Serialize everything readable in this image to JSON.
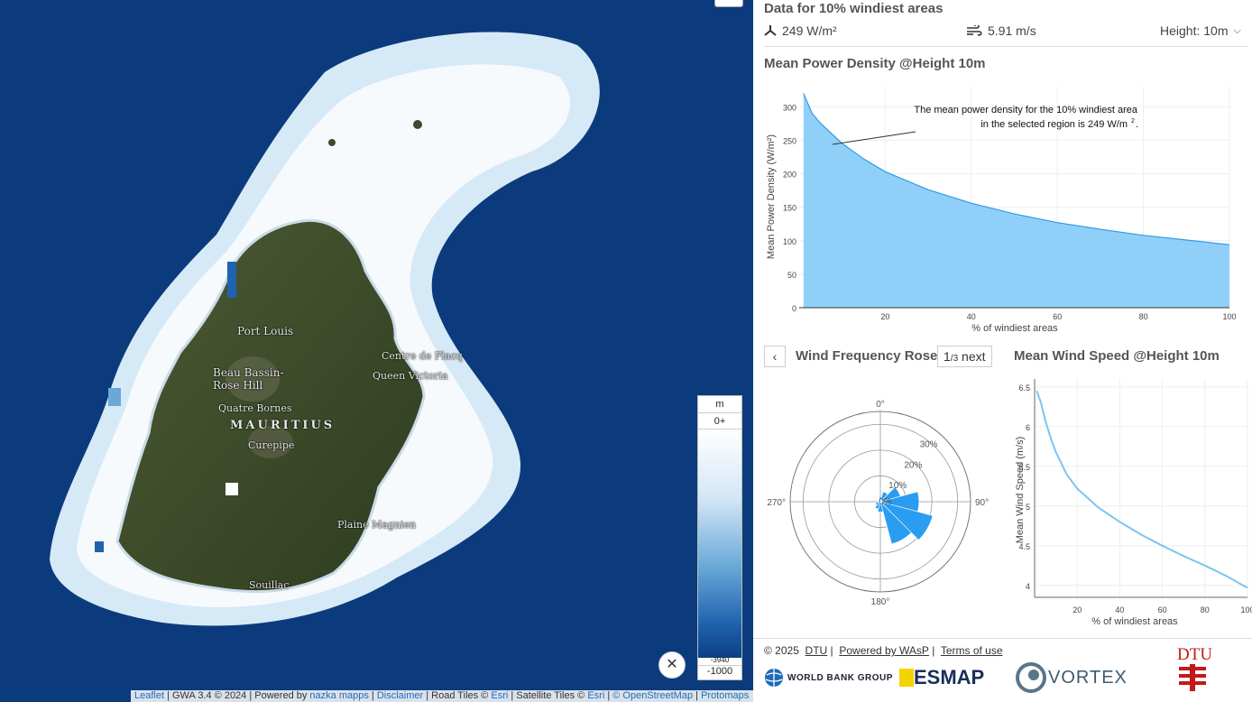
{
  "map": {
    "labels": {
      "port_louis": "Port Louis",
      "centre_flacq": "Centre de Flacq",
      "beau_bassin": "Beau Bassin-\nRose Hill",
      "queen_victoria": "Queen Victoria",
      "quatre_bornes": "Quatre Bornes",
      "mauritius": "MAURITIUS",
      "curepipe": "Curepipe",
      "plaine_magnien": "Plaine Magnien",
      "souillac": "Souillac"
    },
    "legend": {
      "unit": "m",
      "top": "0+",
      "bottom_small": "-3940",
      "bottom": "-1000"
    },
    "close_icon": "✕",
    "attribution": {
      "leaflet": "Leaflet",
      "gwa": " | GWA 3.4 © 2024 | Powered by ",
      "nazka": "nazka mapps",
      "sep1": " | ",
      "disclaimer": "Disclaimer",
      "road": " | Road Tiles © ",
      "esri1": "Esri",
      "sat": " | Satellite Tiles © ",
      "esri2": "Esri",
      "sep2": " | ",
      "osm": "© OpenStreetMap",
      "sep3": " | ",
      "protomaps": "Protomaps"
    }
  },
  "panel": {
    "title": "Data for 10% windiest areas",
    "stats": {
      "power": "249 W/m²",
      "speed": "5.91 m/s",
      "height": "Height: 10m"
    },
    "power_title": "Mean Power Density @Height 10m",
    "power_annotation_1": "The mean power density for the 10% windiest area",
    "power_annotation_2": "in the selected region is 249 W/m",
    "power_annotation_sup": "2",
    "rose_title": "Wind Frequency Rose",
    "pager_current": "1",
    "pager_total": "/3",
    "pager_next": "next",
    "speed_title": "Mean Wind Speed @Height 10m",
    "footer": {
      "copyright": "© 2025",
      "dtu": "DTU",
      "wasp": "Powered by WAsP",
      "terms": "Terms of use"
    },
    "logos": {
      "wbg": "WORLD BANK GROUP",
      "esmap": "ESMAP",
      "vortex": "VORTEX",
      "dtu": "DTU"
    }
  },
  "chart_data": [
    {
      "type": "area",
      "ylabel": "Mean Power Density (W/m²)",
      "xlabel": "% of windiest areas",
      "x": [
        1,
        3,
        5,
        10,
        15,
        20,
        30,
        40,
        50,
        60,
        70,
        80,
        90,
        100
      ],
      "values": [
        320,
        290,
        275,
        245,
        222,
        203,
        176,
        156,
        140,
        127,
        117,
        108,
        101,
        94
      ],
      "xlim": [
        0,
        100
      ],
      "ylim": [
        0,
        330
      ],
      "xticks": [
        "20",
        "40",
        "60",
        "80",
        "100"
      ],
      "yticks": [
        "0",
        "50",
        "100",
        "150",
        "200",
        "250",
        "300"
      ],
      "color": "#90d0f8",
      "line_color": "#2f9be8"
    },
    {
      "type": "bar",
      "subtype": "polar",
      "angular_ticks": [
        "0°",
        "90°",
        "180°",
        "270°"
      ],
      "radial_ticks": [
        "0%",
        "10%",
        "20%",
        "30%"
      ],
      "directions_deg": [
        0,
        30,
        60,
        90,
        120,
        150,
        180,
        210,
        240,
        270,
        300,
        330
      ],
      "values": [
        2,
        4,
        8,
        15,
        21,
        17,
        4,
        3,
        2,
        1,
        1,
        1
      ],
      "rmax": 35,
      "color": "#2a9df0"
    },
    {
      "type": "line",
      "ylabel": "Mean Wind Speed (m/s)",
      "xlabel": "% of windiest areas",
      "x": [
        1,
        3,
        5,
        8,
        10,
        15,
        20,
        30,
        40,
        50,
        60,
        70,
        80,
        90,
        100
      ],
      "values": [
        6.45,
        6.3,
        6.08,
        5.82,
        5.68,
        5.4,
        5.22,
        4.98,
        4.8,
        4.64,
        4.5,
        4.37,
        4.25,
        4.12,
        3.97
      ],
      "xlim": [
        0,
        100
      ],
      "ylim": [
        3.85,
        6.6
      ],
      "xticks": [
        "20",
        "40",
        "60",
        "80",
        "100"
      ],
      "yticks": [
        "4",
        "4.5",
        "5",
        "5.5",
        "6",
        "6.5"
      ],
      "color": "#7cc4f0"
    }
  ]
}
